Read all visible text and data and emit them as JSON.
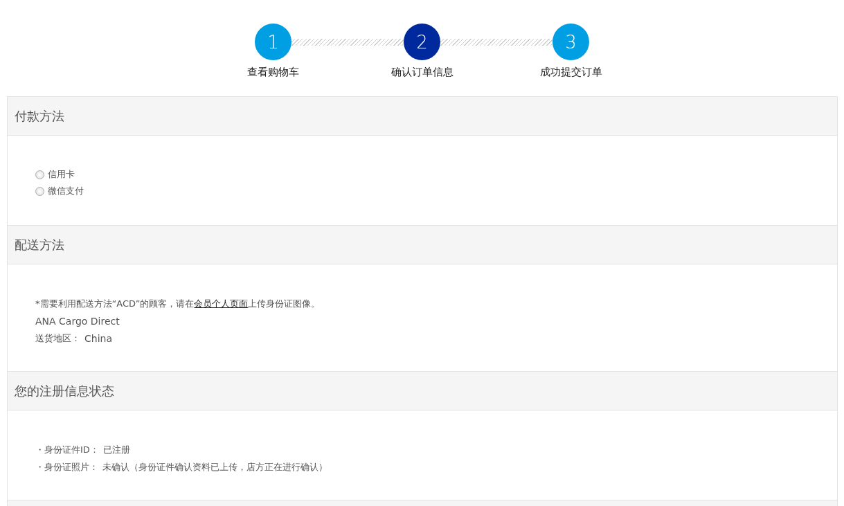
{
  "steps": [
    {
      "number": "1",
      "label": "查看购物车",
      "selected": false
    },
    {
      "number": "2",
      "label": "确认订单信息",
      "selected": true
    },
    {
      "number": "3",
      "label": "成功提交订单",
      "selected": false
    }
  ],
  "sections": [
    {
      "kind": "payment",
      "title": "付款方法",
      "options": [
        {
          "label": "信用卡",
          "selected": false
        },
        {
          "label": "微信支付",
          "selected": false
        }
      ]
    },
    {
      "kind": "shipping",
      "title": "配送方法",
      "note_before": "*需要利用配送方法“ACD”的顾客，请在",
      "note_link": "会员个人页面",
      "note_after": "上传身份证图像。",
      "method": "ANA Cargo Direct",
      "region_label": "送货地区：",
      "region_value": "China"
    },
    {
      "kind": "status",
      "title": "您的注册信息状态",
      "lines": [
        {
          "label": "・身份证件ID：",
          "value": "已注册"
        },
        {
          "label": "・身份证照片：",
          "value": "未确认（身份证件确认资料已上传，店方正在进行确认）"
        }
      ]
    }
  ]
}
